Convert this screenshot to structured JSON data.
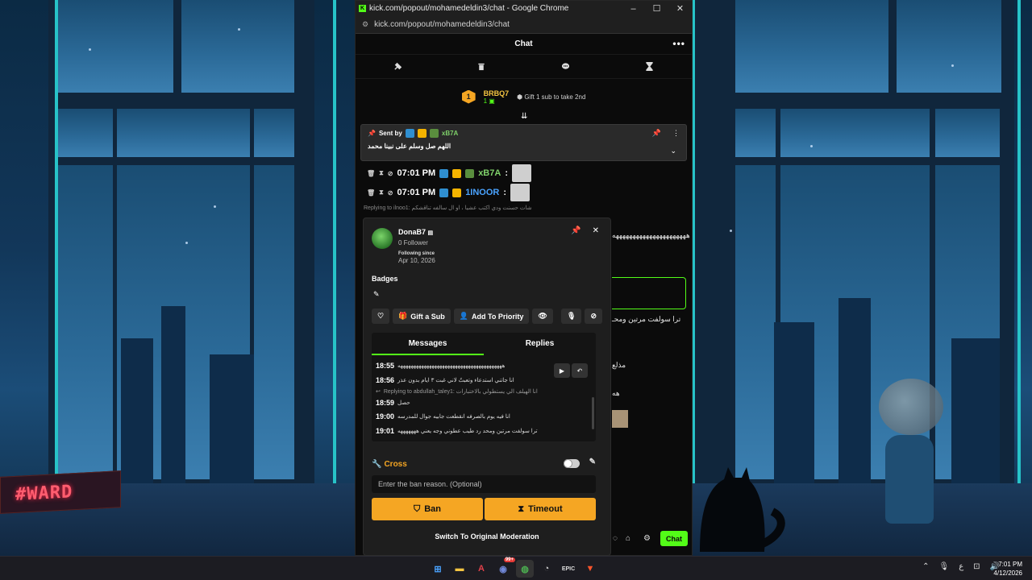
{
  "window": {
    "title": "kick.com/popout/mohamedeldin3/chat - Google Chrome",
    "url": "kick.com/popout/mohamedeldin3/chat"
  },
  "chat": {
    "header": "Chat",
    "leaderboard": {
      "rank": "1",
      "name": "BRBQ7",
      "subs": "1",
      "gift_text": "Gift 1 sub to take 2nd"
    },
    "pinned": {
      "sent_by_label": "Sent by",
      "sender": "xB7A",
      "message": "اللهم صل وسلم على نبينا محمد"
    },
    "messages": [
      {
        "time": "07:01 PM",
        "user": "xB7A",
        "user_color": "#7fd16a"
      },
      {
        "time": "07:01 PM",
        "user": "1INOOR",
        "user_color": "#4aa3ff"
      }
    ],
    "reply_hint": "Replying to ilnoo1: شات حسنت ودي اكتب عشيا ، او ال سالفه تناقشكم"
  },
  "background_lines": {
    "l1": "ههههههههههههههههههههههه",
    "l2": "ترا سولفت مرتين ومحـ",
    "l3": "مذلع",
    "l4": "هه"
  },
  "user_card": {
    "username": "DonaB7",
    "followers": "0 Follower",
    "following_since_label": "Following since",
    "following_since": "Apr 10, 2026",
    "badges_label": "Badges",
    "gift_sub": "Gift a Sub",
    "add_priority": "Add To Priority",
    "tabs": {
      "messages": "Messages",
      "replies": "Replies"
    },
    "history": [
      {
        "time": "18:55",
        "text": "ههههههههههههههههههههههههههههههههههههههههه"
      },
      {
        "time": "18:56",
        "text": "انا جاتني استدعاء وتعبتُ لاني غبت ٣ ايام بدون عذر"
      },
      {
        "time": "",
        "text": "Replying to abdullah_taley1: انا الهيلف الي يستطولي بالاختبارات"
      },
      {
        "time": "18:59",
        "text": "حصل"
      },
      {
        "time": "19:00",
        "text": "انا فيه يوم بالصرفه انقطعت جابيه جوال للمدرسه"
      },
      {
        "time": "19:01",
        "text": "ترا سولفت مرتين ومحد رد طيب عطوني وجه يعني هههههههه"
      }
    ],
    "cross_label": "Cross",
    "ban_reason_placeholder": "Enter the ban reason. (Optional)",
    "ban": "Ban",
    "timeout": "Timeout",
    "switch": "Switch To Original Moderation"
  },
  "bottom": {
    "chat_button": "Chat"
  },
  "taskbar": {
    "time": "7:01 PM",
    "date": "4/12/2026",
    "lang": "ع",
    "discord_badge": "99+"
  },
  "neon_sign": "#WARD",
  "colors": {
    "kick_green": "#53fc18",
    "accent_orange": "#f5a623"
  }
}
